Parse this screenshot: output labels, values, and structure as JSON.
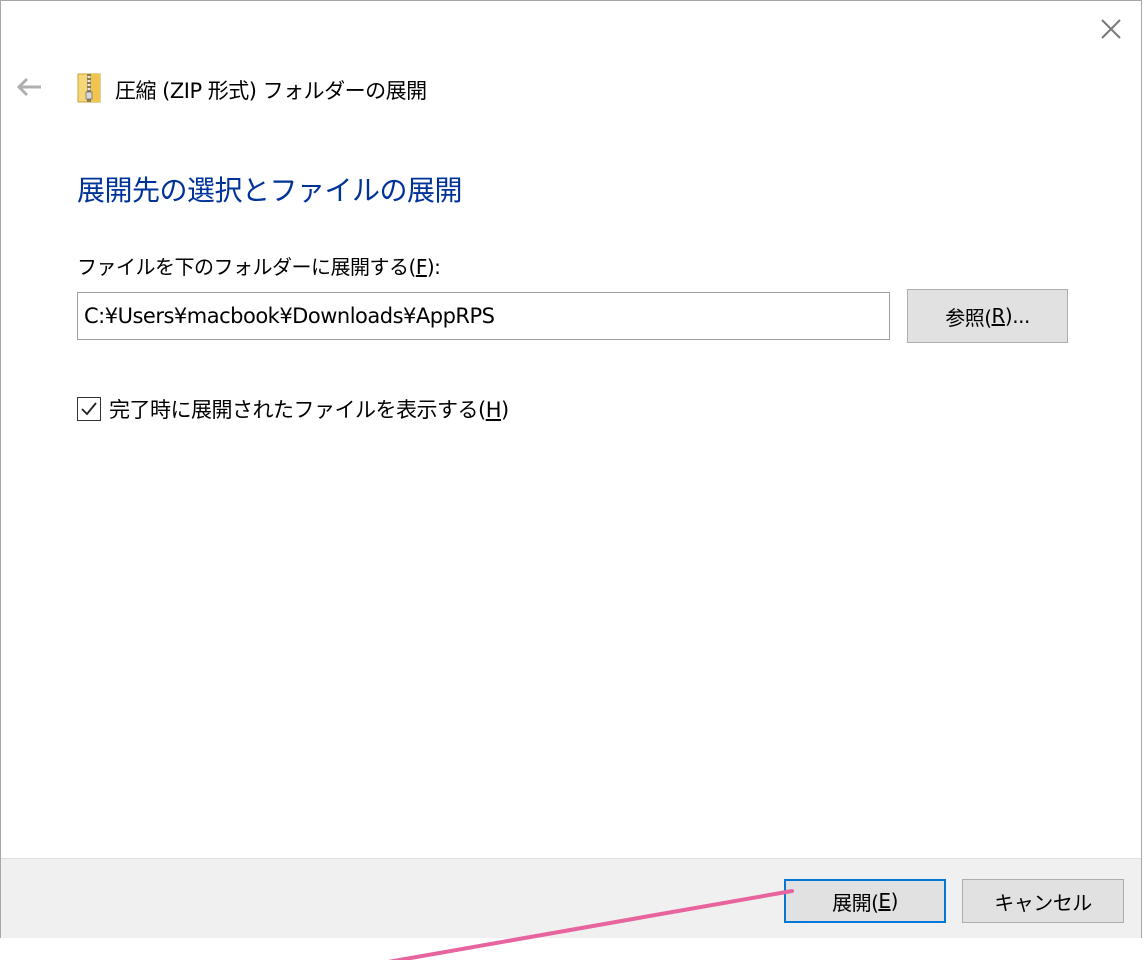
{
  "window": {
    "title": "圧縮 (ZIP 形式) フォルダーの展開",
    "close_icon": "close-icon",
    "back_icon": "back-arrow-icon",
    "title_icon": "zip-folder-icon"
  },
  "main": {
    "heading": "展開先の選択とファイルの展開",
    "dest_label_text": "ファイルを下のフォルダーに展開する(",
    "dest_label_accel": "F",
    "dest_label_suffix": "):",
    "path_value": "C:¥Users¥macbook¥Downloads¥AppRPS",
    "browse_text": "参照(",
    "browse_accel": "R",
    "browse_suffix": ")...",
    "show_files_checked": true,
    "show_files_text": "完了時に展開されたファイルを表示する(",
    "show_files_accel": "H",
    "show_files_suffix": ")"
  },
  "footer": {
    "extract_text": "展開(",
    "extract_accel": "E",
    "extract_suffix": ")",
    "cancel_label": "キャンセル"
  },
  "colors": {
    "heading": "#003399",
    "footer_bg": "#f0f0f0",
    "button_bg": "#e1e1e1",
    "default_button_border": "#0078d7",
    "annotation": "#e8649e"
  }
}
